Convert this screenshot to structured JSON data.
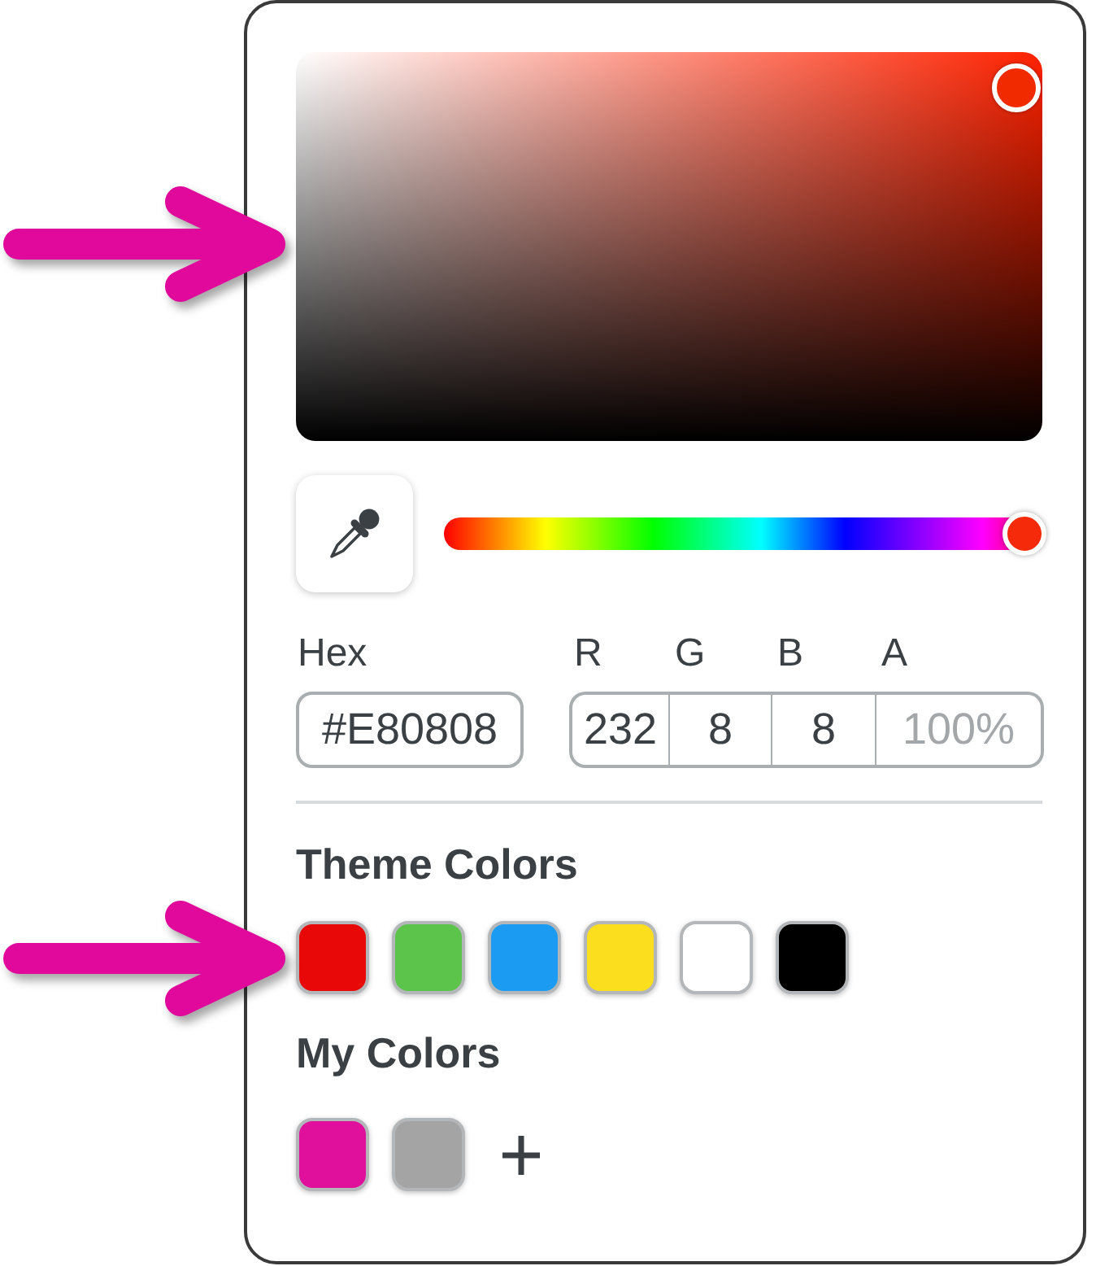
{
  "color_area": {
    "saturation": {
      "level": 0.965
    },
    "brightness": {
      "level": 0.91
    }
  },
  "hue_slider": {
    "level": 0.97
  },
  "hex": {
    "label": "Hex",
    "value": "#E80808"
  },
  "channels": [
    {
      "label": "R",
      "value": "232"
    },
    {
      "label": "G",
      "value": "8"
    },
    {
      "label": "B",
      "value": "8"
    },
    {
      "label": "A",
      "placeholder": "100%"
    }
  ],
  "theme_colors": {
    "title": "Theme Colors",
    "swatches": [
      {
        "color": "#e80808"
      },
      {
        "color": "#5dc44b"
      },
      {
        "color": "#1b9cf2"
      },
      {
        "color": "#fbdf1f"
      },
      {
        "color": "#ffffff"
      },
      {
        "color": "#000000"
      }
    ]
  },
  "my_colors": {
    "title": "My Colors",
    "swatches": [
      {
        "color": "#e0109c"
      },
      {
        "color": "#a4a4a4"
      }
    ]
  }
}
